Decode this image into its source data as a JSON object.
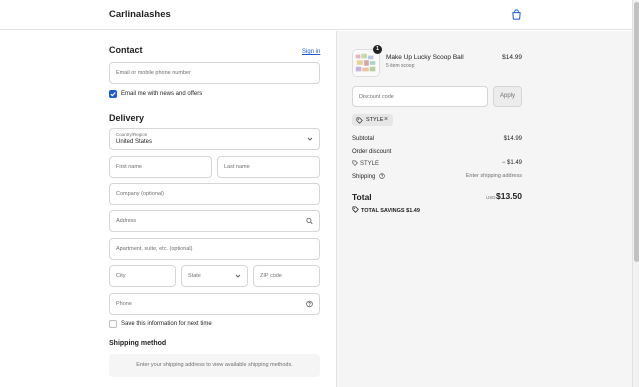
{
  "header": {
    "logo": "Carlinalashes",
    "cart_icon": "shopping-bag-icon"
  },
  "contact": {
    "title": "Contact",
    "sign_in": "Sign in",
    "email_placeholder": "Email or mobile phone number",
    "newsletter_label": "Email me with news and offers",
    "newsletter_checked": true
  },
  "delivery": {
    "title": "Delivery",
    "country_label": "Country/Region",
    "country_value": "United States",
    "first_name": "First name",
    "last_name": "Last name",
    "company": "Company (optional)",
    "address": "Address",
    "apartment": "Apartment, suite, etc. (optional)",
    "city": "City",
    "state": "State",
    "zip": "ZIP code",
    "phone": "Phone",
    "save_info_label": "Save this information for next time",
    "save_info_checked": false
  },
  "shipping_method": {
    "title": "Shipping method",
    "message": "Enter your shipping address to view available shipping methods."
  },
  "order": {
    "item": {
      "quantity": "1",
      "name": "Make Up Lucky Scoop Ball",
      "variant": "5 item scoop",
      "price": "$14.99"
    },
    "discount_placeholder": "Discount code",
    "apply_label": "Apply",
    "applied_code": "STYLE",
    "subtotal_label": "Subtotal",
    "subtotal_value": "$14.99",
    "order_discount_label": "Order discount",
    "discount_code_label": "STYLE",
    "discount_value": "− $1.49",
    "shipping_label": "Shipping",
    "shipping_value": "Enter shipping address",
    "total_label": "Total",
    "total_currency": "USD",
    "total_value": "$13.50",
    "savings_label": "TOTAL SAVINGS",
    "savings_value": "$1.49"
  },
  "colors": {
    "accent": "#1a5bd8",
    "summary_bg": "#f5f5f5",
    "border": "#d6d6d6"
  }
}
